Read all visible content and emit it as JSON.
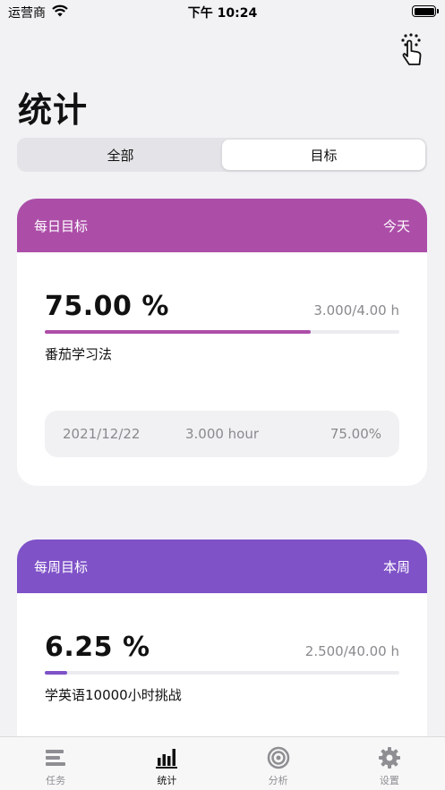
{
  "status_bar": {
    "carrier": "运营商",
    "time": "下午 10:24"
  },
  "header": {
    "title": "统计"
  },
  "segmented": {
    "options": [
      {
        "label": "全部",
        "selected": false
      },
      {
        "label": "目标",
        "selected": true
      }
    ]
  },
  "daily_card": {
    "title": "每日目标",
    "period": "今天",
    "percent": "75.00 %",
    "ratio": "3.000/4.00 h",
    "progress": 0.75,
    "goal_name": "番茄学习法",
    "record": {
      "date": "2021/12/22",
      "duration": "3.000 hour",
      "percent": "75.00%"
    },
    "color": "#ac4ea8"
  },
  "weekly_card": {
    "title": "每周目标",
    "period": "本周",
    "percent": "6.25 %",
    "ratio": "2.500/40.00 h",
    "progress": 0.0625,
    "goal_name": "学英语10000小时挑战",
    "color": "#7f52c8"
  },
  "tab_bar": {
    "tabs": [
      {
        "label": "任务",
        "icon": "tasks-icon",
        "active": false
      },
      {
        "label": "统计",
        "icon": "bar-chart-icon",
        "active": true
      },
      {
        "label": "分析",
        "icon": "target-icon",
        "active": false
      },
      {
        "label": "设置",
        "icon": "gear-icon",
        "active": false
      }
    ]
  }
}
